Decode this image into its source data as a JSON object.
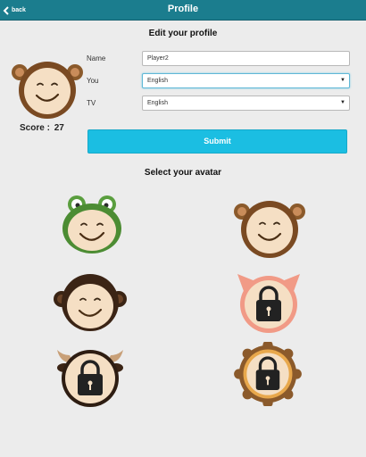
{
  "header": {
    "back_label": "back",
    "title": "Profile"
  },
  "edit_section": {
    "title": "Edit your profile"
  },
  "profile": {
    "score_label": "Score :",
    "score_value": "27"
  },
  "form": {
    "name_label": "Name",
    "name_value": "Player2",
    "you_label": "You",
    "you_value": "English",
    "tv_label": "TV",
    "tv_value": "English",
    "submit_label": "Submit"
  },
  "avatar_section": {
    "title": "Select your avatar"
  },
  "avatars": [
    {
      "name": "frog",
      "locked": false
    },
    {
      "name": "monkey-light",
      "locked": false
    },
    {
      "name": "monkey-dark",
      "locked": false
    },
    {
      "name": "pig",
      "locked": true
    },
    {
      "name": "bull",
      "locked": true
    },
    {
      "name": "lion",
      "locked": true
    }
  ],
  "colors": {
    "header_bg": "#1b7d8e",
    "submit_bg": "#1bbee2",
    "page_bg": "#ececec"
  }
}
